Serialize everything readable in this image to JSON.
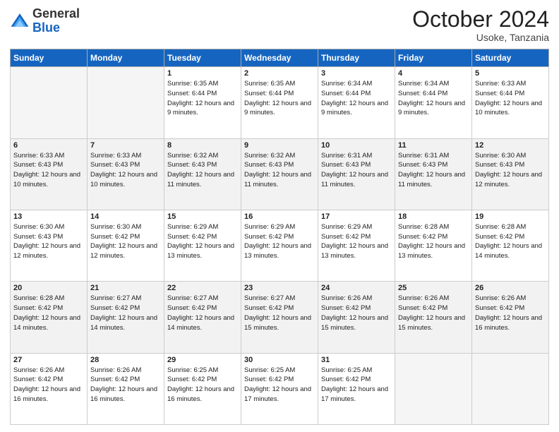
{
  "logo": {
    "general": "General",
    "blue": "Blue"
  },
  "header": {
    "month": "October 2024",
    "location": "Usoke, Tanzania"
  },
  "weekdays": [
    "Sunday",
    "Monday",
    "Tuesday",
    "Wednesday",
    "Thursday",
    "Friday",
    "Saturday"
  ],
  "weeks": [
    [
      {
        "day": "",
        "sunrise": "",
        "sunset": "",
        "daylight": ""
      },
      {
        "day": "",
        "sunrise": "",
        "sunset": "",
        "daylight": ""
      },
      {
        "day": "1",
        "sunrise": "Sunrise: 6:35 AM",
        "sunset": "Sunset: 6:44 PM",
        "daylight": "Daylight: 12 hours and 9 minutes."
      },
      {
        "day": "2",
        "sunrise": "Sunrise: 6:35 AM",
        "sunset": "Sunset: 6:44 PM",
        "daylight": "Daylight: 12 hours and 9 minutes."
      },
      {
        "day": "3",
        "sunrise": "Sunrise: 6:34 AM",
        "sunset": "Sunset: 6:44 PM",
        "daylight": "Daylight: 12 hours and 9 minutes."
      },
      {
        "day": "4",
        "sunrise": "Sunrise: 6:34 AM",
        "sunset": "Sunset: 6:44 PM",
        "daylight": "Daylight: 12 hours and 9 minutes."
      },
      {
        "day": "5",
        "sunrise": "Sunrise: 6:33 AM",
        "sunset": "Sunset: 6:44 PM",
        "daylight": "Daylight: 12 hours and 10 minutes."
      }
    ],
    [
      {
        "day": "6",
        "sunrise": "Sunrise: 6:33 AM",
        "sunset": "Sunset: 6:43 PM",
        "daylight": "Daylight: 12 hours and 10 minutes."
      },
      {
        "day": "7",
        "sunrise": "Sunrise: 6:33 AM",
        "sunset": "Sunset: 6:43 PM",
        "daylight": "Daylight: 12 hours and 10 minutes."
      },
      {
        "day": "8",
        "sunrise": "Sunrise: 6:32 AM",
        "sunset": "Sunset: 6:43 PM",
        "daylight": "Daylight: 12 hours and 11 minutes."
      },
      {
        "day": "9",
        "sunrise": "Sunrise: 6:32 AM",
        "sunset": "Sunset: 6:43 PM",
        "daylight": "Daylight: 12 hours and 11 minutes."
      },
      {
        "day": "10",
        "sunrise": "Sunrise: 6:31 AM",
        "sunset": "Sunset: 6:43 PM",
        "daylight": "Daylight: 12 hours and 11 minutes."
      },
      {
        "day": "11",
        "sunrise": "Sunrise: 6:31 AM",
        "sunset": "Sunset: 6:43 PM",
        "daylight": "Daylight: 12 hours and 11 minutes."
      },
      {
        "day": "12",
        "sunrise": "Sunrise: 6:30 AM",
        "sunset": "Sunset: 6:43 PM",
        "daylight": "Daylight: 12 hours and 12 minutes."
      }
    ],
    [
      {
        "day": "13",
        "sunrise": "Sunrise: 6:30 AM",
        "sunset": "Sunset: 6:43 PM",
        "daylight": "Daylight: 12 hours and 12 minutes."
      },
      {
        "day": "14",
        "sunrise": "Sunrise: 6:30 AM",
        "sunset": "Sunset: 6:42 PM",
        "daylight": "Daylight: 12 hours and 12 minutes."
      },
      {
        "day": "15",
        "sunrise": "Sunrise: 6:29 AM",
        "sunset": "Sunset: 6:42 PM",
        "daylight": "Daylight: 12 hours and 13 minutes."
      },
      {
        "day": "16",
        "sunrise": "Sunrise: 6:29 AM",
        "sunset": "Sunset: 6:42 PM",
        "daylight": "Daylight: 12 hours and 13 minutes."
      },
      {
        "day": "17",
        "sunrise": "Sunrise: 6:29 AM",
        "sunset": "Sunset: 6:42 PM",
        "daylight": "Daylight: 12 hours and 13 minutes."
      },
      {
        "day": "18",
        "sunrise": "Sunrise: 6:28 AM",
        "sunset": "Sunset: 6:42 PM",
        "daylight": "Daylight: 12 hours and 13 minutes."
      },
      {
        "day": "19",
        "sunrise": "Sunrise: 6:28 AM",
        "sunset": "Sunset: 6:42 PM",
        "daylight": "Daylight: 12 hours and 14 minutes."
      }
    ],
    [
      {
        "day": "20",
        "sunrise": "Sunrise: 6:28 AM",
        "sunset": "Sunset: 6:42 PM",
        "daylight": "Daylight: 12 hours and 14 minutes."
      },
      {
        "day": "21",
        "sunrise": "Sunrise: 6:27 AM",
        "sunset": "Sunset: 6:42 PM",
        "daylight": "Daylight: 12 hours and 14 minutes."
      },
      {
        "day": "22",
        "sunrise": "Sunrise: 6:27 AM",
        "sunset": "Sunset: 6:42 PM",
        "daylight": "Daylight: 12 hours and 14 minutes."
      },
      {
        "day": "23",
        "sunrise": "Sunrise: 6:27 AM",
        "sunset": "Sunset: 6:42 PM",
        "daylight": "Daylight: 12 hours and 15 minutes."
      },
      {
        "day": "24",
        "sunrise": "Sunrise: 6:26 AM",
        "sunset": "Sunset: 6:42 PM",
        "daylight": "Daylight: 12 hours and 15 minutes."
      },
      {
        "day": "25",
        "sunrise": "Sunrise: 6:26 AM",
        "sunset": "Sunset: 6:42 PM",
        "daylight": "Daylight: 12 hours and 15 minutes."
      },
      {
        "day": "26",
        "sunrise": "Sunrise: 6:26 AM",
        "sunset": "Sunset: 6:42 PM",
        "daylight": "Daylight: 12 hours and 16 minutes."
      }
    ],
    [
      {
        "day": "27",
        "sunrise": "Sunrise: 6:26 AM",
        "sunset": "Sunset: 6:42 PM",
        "daylight": "Daylight: 12 hours and 16 minutes."
      },
      {
        "day": "28",
        "sunrise": "Sunrise: 6:26 AM",
        "sunset": "Sunset: 6:42 PM",
        "daylight": "Daylight: 12 hours and 16 minutes."
      },
      {
        "day": "29",
        "sunrise": "Sunrise: 6:25 AM",
        "sunset": "Sunset: 6:42 PM",
        "daylight": "Daylight: 12 hours and 16 minutes."
      },
      {
        "day": "30",
        "sunrise": "Sunrise: 6:25 AM",
        "sunset": "Sunset: 6:42 PM",
        "daylight": "Daylight: 12 hours and 17 minutes."
      },
      {
        "day": "31",
        "sunrise": "Sunrise: 6:25 AM",
        "sunset": "Sunset: 6:42 PM",
        "daylight": "Daylight: 12 hours and 17 minutes."
      },
      {
        "day": "",
        "sunrise": "",
        "sunset": "",
        "daylight": ""
      },
      {
        "day": "",
        "sunrise": "",
        "sunset": "",
        "daylight": ""
      }
    ]
  ]
}
